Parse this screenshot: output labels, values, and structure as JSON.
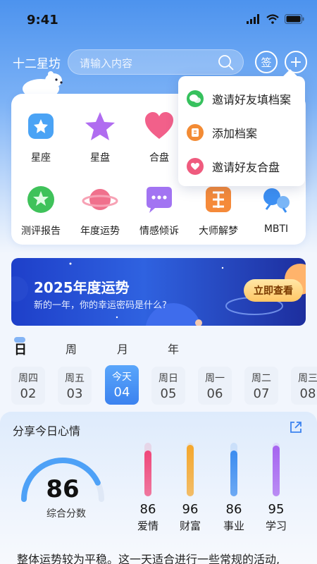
{
  "status_bar": {
    "time": "9:41"
  },
  "header": {
    "brand": "十二星坊",
    "search_placeholder": "请输入内容",
    "sign_label": "签",
    "plus_label": "+"
  },
  "functions": [
    {
      "label": "星座",
      "icon": "star-badge-icon",
      "color": "#4aa3f5"
    },
    {
      "label": "星盘",
      "icon": "star-icon",
      "color": "#b06cf0"
    },
    {
      "label": "合盘",
      "icon": "heart-icon",
      "color": "#f2608a"
    },
    {
      "label": "测评报告",
      "icon": "star-circle-icon",
      "color": "#3fc25a"
    },
    {
      "label": "年度运势",
      "icon": "planet-icon",
      "color": "#f0708c"
    },
    {
      "label": "情感倾诉",
      "icon": "chat-bubble-icon",
      "color": "#a274f2"
    },
    {
      "label": "大师解梦",
      "icon": "dream-icon",
      "color": "#f58a3a"
    },
    {
      "label": "MBTI",
      "icon": "people-icon",
      "color": "#3c8ff2"
    }
  ],
  "dropdown": [
    {
      "label": "邀请好友填档案",
      "icon": "wechat-icon",
      "color": "#36c15d"
    },
    {
      "label": "添加档案",
      "icon": "file-icon",
      "color": "#f38b34"
    },
    {
      "label": "邀请好友合盘",
      "icon": "heart-link-icon",
      "color": "#ef5b7e"
    }
  ],
  "banner": {
    "title": "2025年度运势",
    "subtitle": "新的一年，你的幸运密码是什么?",
    "button": "立即查看"
  },
  "tabs": [
    "日",
    "周",
    "月",
    "年"
  ],
  "days": [
    {
      "weekday": "周四",
      "date": "02"
    },
    {
      "weekday": "周五",
      "date": "03"
    },
    {
      "weekday": "今天",
      "date": "04",
      "today": true
    },
    {
      "weekday": "周日",
      "date": "05"
    },
    {
      "weekday": "周一",
      "date": "06"
    },
    {
      "weekday": "周二",
      "date": "07"
    },
    {
      "weekday": "周三",
      "date": "08"
    }
  ],
  "mood": {
    "title": "分享今日心情",
    "score": "86",
    "score_label": "综合分数",
    "scores": [
      {
        "name": "爱情",
        "value": 86,
        "color": "#f0477a"
      },
      {
        "name": "财富",
        "value": 96,
        "color": "#f5a72c"
      },
      {
        "name": "事业",
        "value": 86,
        "color": "#3b8cf0"
      },
      {
        "name": "学习",
        "value": 95,
        "color": "#a664f0"
      }
    ],
    "summary": "整体运势较为平稳。这一天适合进行一些常规的活动,"
  }
}
